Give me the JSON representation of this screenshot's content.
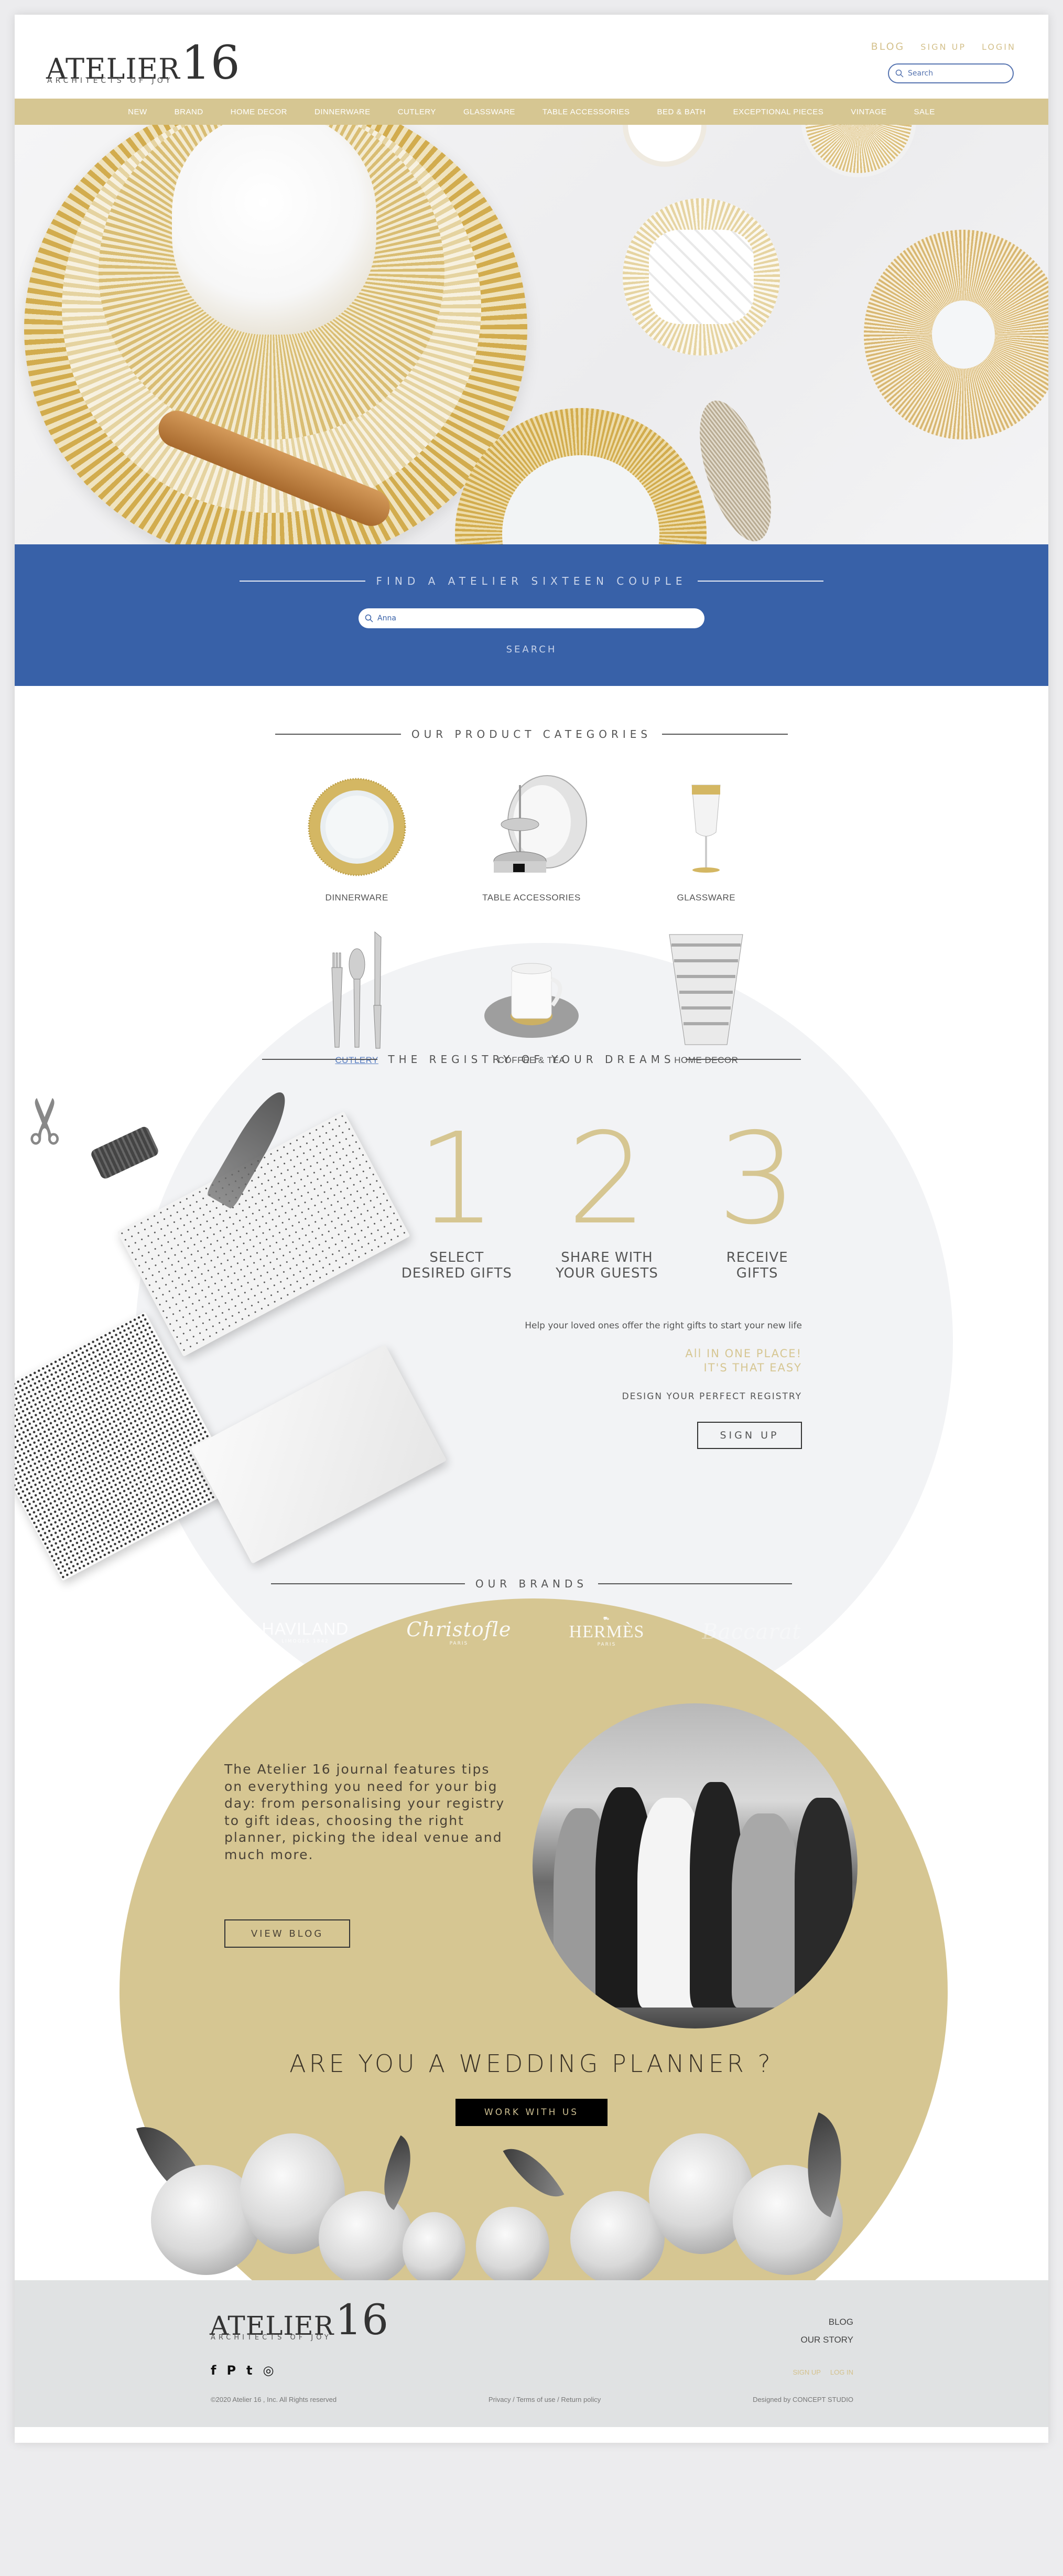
{
  "brand": {
    "name": "ATELIER",
    "number": "16",
    "tagline": "ARCHITECTS OF JOY"
  },
  "header": {
    "links": [
      {
        "label": "BLOG"
      },
      {
        "label": "SIGN UP"
      },
      {
        "label": "LOGIN"
      }
    ],
    "search": {
      "placeholder": "Search",
      "value": ""
    }
  },
  "nav": {
    "items": [
      {
        "label": "NEW"
      },
      {
        "label": "BRAND"
      },
      {
        "label": "HOME DECOR"
      },
      {
        "label": "DINNERWARE"
      },
      {
        "label": "CUTLERY"
      },
      {
        "label": "GLASSWARE"
      },
      {
        "label": "TABLE ACCESSORIES"
      },
      {
        "label": "BED & BATH"
      },
      {
        "label": "EXCEPTIONAL PIECES"
      },
      {
        "label": "VINTAGE"
      },
      {
        "label": "SALE"
      }
    ]
  },
  "couple_search": {
    "title": "FIND A ATELIER SIXTEEN COUPLE",
    "input_value": "Anna",
    "button_label": "SEARCH"
  },
  "categories": {
    "title": "OUR PRODUCT CATEGORIES",
    "items": [
      {
        "label": "DINNERWARE",
        "icon": "plate-icon"
      },
      {
        "label": "TABLE ACCESSORIES",
        "icon": "table-accessory-icon"
      },
      {
        "label": "GLASSWARE",
        "icon": "champagne-glass-icon"
      },
      {
        "label": "CUTLERY",
        "icon": "cutlery-icon",
        "hovered": true
      },
      {
        "label": "COFFEE & TEA",
        "icon": "cup-icon"
      },
      {
        "label": "HOME DECOR",
        "icon": "vase-icon"
      }
    ]
  },
  "registry": {
    "title": "THE REGISTRY OF YOUR DREAMS",
    "steps": [
      {
        "number": "1",
        "label": "SELECT\nDESIRED GIFTS"
      },
      {
        "number": "2",
        "label": "SHARE WITH\nYOUR GUESTS"
      },
      {
        "number": "3",
        "label": "RECEIVE\nGIFTS"
      }
    ],
    "help_text": "Help your loved ones offer the right gifts to start your new life",
    "easy_text": "All IN ONE  PLACE!\nIT'S THAT EASY",
    "design_text": "DESIGN YOUR PERFECT REGISTRY",
    "signup_label": "SIGN UP"
  },
  "brands": {
    "title": "OUR BRANDS",
    "items": [
      {
        "name": "HAVILAND",
        "sub": "LIMOGES 1842"
      },
      {
        "name": "Christofle",
        "sub": "PARIS"
      },
      {
        "name": "HERMÈS",
        "sub": "PARIS"
      },
      {
        "name": "Baccarat",
        "sub": ""
      }
    ]
  },
  "journal": {
    "text": "The Atelier 16 journal features tips on everything you need for your big day: from personalising your registry to gift ideas, choosing the right planner, picking the ideal venue and much more.",
    "button_label": "VIEW BLOG"
  },
  "planner": {
    "title": "ARE YOU A WEDDING PLANNER ?",
    "button_label": "WORK WITH US"
  },
  "footer": {
    "links": [
      {
        "label": "BLOG"
      },
      {
        "label": "OUR STORY"
      }
    ],
    "social": [
      {
        "name": "facebook",
        "glyph": "f"
      },
      {
        "name": "pinterest",
        "glyph": "P"
      },
      {
        "name": "twitter",
        "glyph": "t"
      },
      {
        "name": "instagram",
        "glyph": "◎"
      }
    ],
    "auth": [
      {
        "label": "SIGN UP"
      },
      {
        "label": "LOG IN"
      }
    ],
    "copyright": "©2020 Atelier 16 , Inc. All Rights reserved",
    "legal": "Privacy / Terms of use / Return policy",
    "credit": "Designed by CONCEPT STUDIO"
  },
  "colors": {
    "gold": "#d6c692",
    "blue": "#3861a8",
    "light_gray": "#f2f3f5",
    "footer_gray": "#e0e2e3"
  }
}
